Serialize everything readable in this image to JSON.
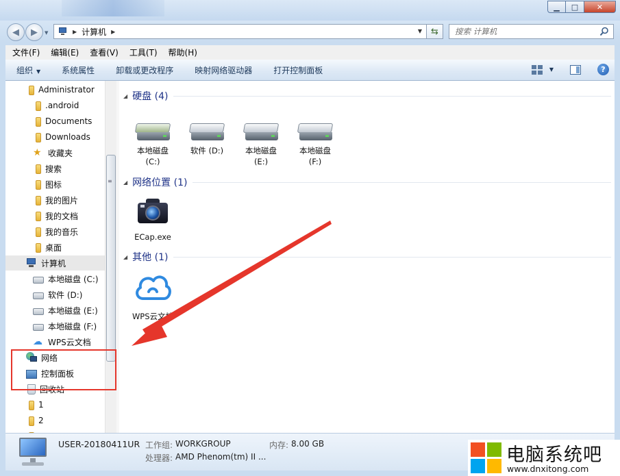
{
  "window": {
    "min_label": "▁",
    "max_label": "□",
    "close_label": "✕"
  },
  "address": {
    "crumb": "计算机",
    "search_placeholder": "搜索 计算机"
  },
  "menu": [
    "文件(F)",
    "编辑(E)",
    "查看(V)",
    "工具(T)",
    "帮助(H)"
  ],
  "commands": {
    "organize": "组织",
    "system_properties": "系统属性",
    "uninstall": "卸载或更改程序",
    "map_drive": "映射网络驱动器",
    "control_panel": "打开控制面板"
  },
  "nav": {
    "administrator": "Administrator",
    "android": ".android",
    "documents": "Documents",
    "downloads": "Downloads",
    "favorites": "收藏夹",
    "search": "搜索",
    "icons": "图标",
    "pictures": "我的图片",
    "mydocs": "我的文档",
    "music": "我的音乐",
    "desktop": "桌面",
    "computer": "计算机",
    "drive_c": "本地磁盘 (C:)",
    "drive_d": "软件 (D:)",
    "drive_e": "本地磁盘 (E:)",
    "drive_f": "本地磁盘 (F:)",
    "wps": "WPS云文档",
    "network": "网络",
    "control_panel": "控制面板",
    "recycle": "回收站",
    "folder1": "1",
    "folder2": "2"
  },
  "groups": {
    "hdd": "硬盘 (4)",
    "netloc": "网络位置 (1)",
    "other": "其他 (1)"
  },
  "tiles": {
    "c_line1": "本地磁盘",
    "c_line2": "(C:)",
    "d_line1": "软件 (D:)",
    "e_line1": "本地磁盘",
    "e_line2": "(E:)",
    "f_line1": "本地磁盘",
    "f_line2": "(F:)",
    "ecap": "ECap.exe",
    "wps": "WPS云文档"
  },
  "details": {
    "computer_name": "USER-20180411UR",
    "workgroup_label": "工作组:",
    "workgroup_value": "WORKGROUP",
    "memory_label": "内存:",
    "memory_value": "8.00 GB",
    "processor_label": "处理器:",
    "processor_value": "AMD Phenom(tm) II ..."
  },
  "watermark": {
    "title": "电脑系统吧",
    "url": "www.dnxitong.com"
  },
  "colors": {
    "arrow": "#e5362b",
    "group_title": "#1e3287",
    "command_text": "#1e395b"
  }
}
